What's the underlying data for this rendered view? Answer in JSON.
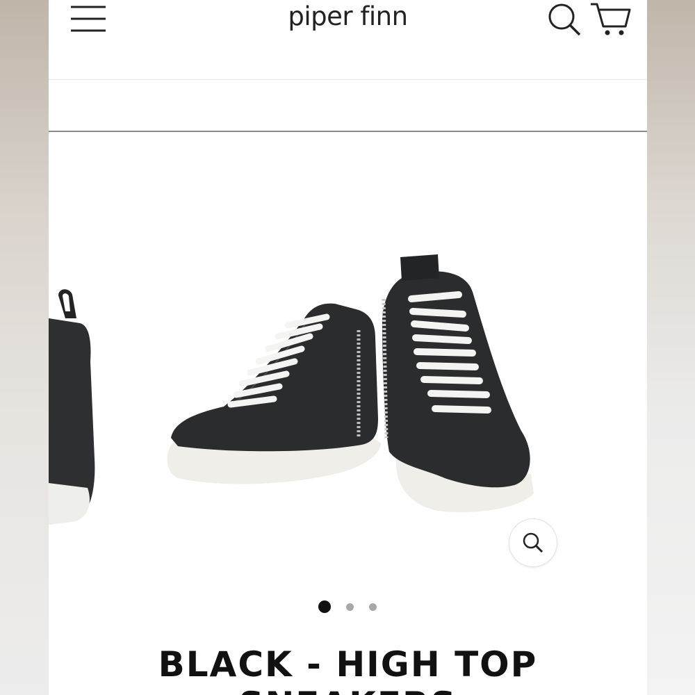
{
  "header": {
    "brand": "piper finn",
    "menu_icon": "hamburger-menu-icon",
    "search_icon": "search-icon",
    "cart_icon": "cart-icon"
  },
  "product": {
    "images": [
      {
        "alt": "black high top sneakers",
        "active": true
      },
      {
        "alt": "",
        "active": false
      },
      {
        "alt": "",
        "active": false
      }
    ],
    "zoom_icon": "zoom-icon",
    "title_line1": "BLACK - HIGH TOP",
    "title_line2": "SNEAKERS"
  },
  "colors": {
    "text": "#111111",
    "dot_active": "#111111",
    "dot_inactive": "#a8a8a8",
    "divider": "#8a8a8a"
  }
}
